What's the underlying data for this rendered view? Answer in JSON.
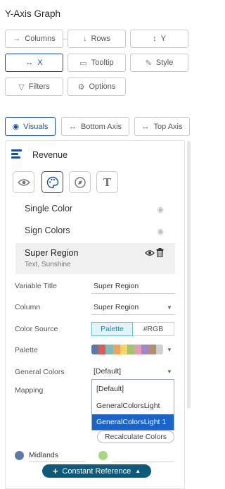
{
  "header": {
    "title": "Y-Axis Graph"
  },
  "buttons": {
    "columns": "Columns",
    "rows": "Rows",
    "y": "Y",
    "x": "X",
    "tooltip": "Tooltip",
    "style": "Style",
    "filters": "Filters",
    "options": "Options"
  },
  "tabs": {
    "visuals": "Visuals",
    "bottom_axis": "Bottom Axis",
    "top_axis": "Top Axis"
  },
  "panel": {
    "title": "Revenue",
    "list": [
      {
        "label": "Single Color"
      },
      {
        "label": "Sign Colors"
      },
      {
        "label": "Super Region",
        "sublabel": "Text, Sunshine"
      }
    ],
    "properties": {
      "variable_title_label": "Variable Title",
      "variable_title_value": "Super Region",
      "column_label": "Column",
      "column_value": "Super Region",
      "color_source_label": "Color Source",
      "color_source_palette": "Palette",
      "color_source_rgb": "#RGB",
      "palette_label": "Palette",
      "general_colors_label": "General Colors",
      "general_colors_value": "[Default]",
      "mapping_label": "Mapping"
    },
    "palette_colors": [
      "#5b7ba6",
      "#d95d5d",
      "#7dbcb8",
      "#f1a55a",
      "#f3d66e",
      "#9cc76f",
      "#e79ab4",
      "#9e89c8",
      "#b28f6e",
      "#cfcfcf"
    ],
    "dropdown_options": [
      "[Default]",
      "GeneralColorsLight",
      "GeneralColorsLight 1"
    ],
    "recalculate": "Recalculate Colors",
    "mapping_items": [
      {
        "label": "Midlands",
        "color": "#5b7ba6"
      },
      {
        "label": "",
        "color": "#a6d783"
      }
    ]
  },
  "footer": {
    "constant_reference": "Constant Reference"
  },
  "colors": {
    "accent": "#1a4f9c",
    "selected": "#1a63c7",
    "footer_button": "#0e5a7a"
  }
}
